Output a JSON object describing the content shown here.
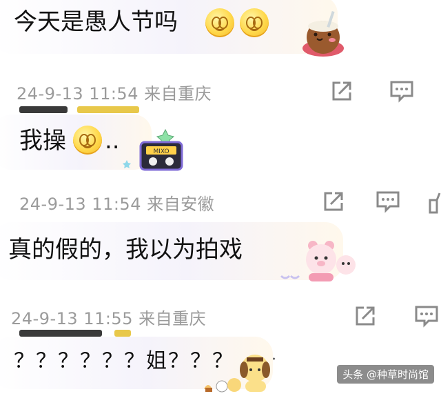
{
  "comments": [
    {
      "text": "今天是愚人节吗",
      "emoji": [
        "smile-emoji",
        "smile-emoji"
      ],
      "sticker": "coconut-drink-sticker",
      "meta": "24-9-13 11:54 来自重庆"
    },
    {
      "text": "我操",
      "suffix": "..",
      "emoji": [
        "smile-emoji"
      ],
      "sticker": "cassette-tape-sticker",
      "sticker_text": "MIXO",
      "meta": "24-9-13 11:54 来自安徽"
    },
    {
      "text": "真的假的，我以为拍戏",
      "sticker": "pink-bear-sticker",
      "meta": "24-9-13 11:55 来自重庆"
    },
    {
      "text": "？？？？？？姐？？？",
      "sticker": "pudding-dog-sticker"
    }
  ],
  "actions": {
    "share_icon": "share-icon",
    "comment_icon": "comment-icon",
    "like_icon": "like-icon"
  },
  "watermark": "头条 @种草时尚馆",
  "colors": {
    "meta_text": "#9b9b9b",
    "icon": "#8a8a8a",
    "emoji_yellow": "#ffd84a"
  }
}
